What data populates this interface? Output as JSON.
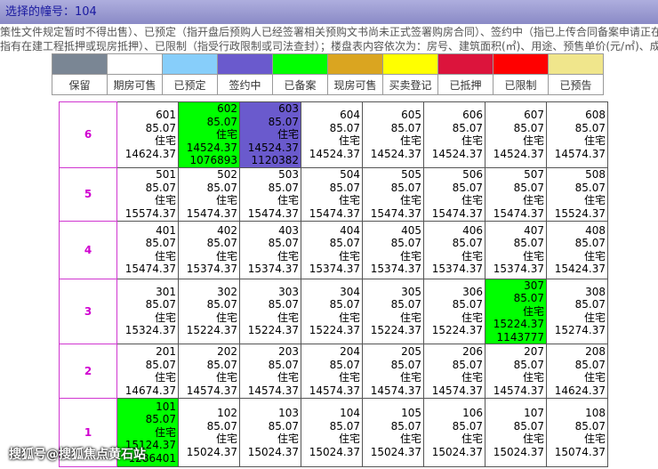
{
  "header": {
    "title": "选择的幢号：104"
  },
  "notice": {
    "line1": "策性文件规定暂时不得出售）、已预定（指开盘后预购人已经签署相关预购文书尚未正式签署购房合同）、签约中（指已上传合同备案申请正在审核",
    "line2": "指有在建工程抵押或现房抵押）、已限制（指受行政限制或司法查封）；楼盘表内容依次为：房号、建筑面积(㎡)、用途、预售单价(元/㎡)、成交总价"
  },
  "legend": [
    {
      "label": "保留",
      "color": "#7a8694"
    },
    {
      "label": "期房可售",
      "color": "#ffffff"
    },
    {
      "label": "已预定",
      "color": "#87cefa"
    },
    {
      "label": "签约中",
      "color": "#6a5acd"
    },
    {
      "label": "已备案",
      "color": "#00ff00"
    },
    {
      "label": "现房可售",
      "color": "#daa520"
    },
    {
      "label": "买卖登记",
      "color": "#ffff00"
    },
    {
      "label": "已抵押",
      "color": "#dc143c"
    },
    {
      "label": "已限制",
      "color": "#ff0000"
    },
    {
      "label": "已预告",
      "color": "#f0e68c"
    }
  ],
  "floors": [
    {
      "floor": "6",
      "units": [
        {
          "room": "601",
          "area": "85.07",
          "use": "住宅",
          "price": "14624.37",
          "total": "",
          "status": "期房可售"
        },
        {
          "room": "602",
          "area": "85.07",
          "use": "住宅",
          "price": "14524.37",
          "total": "1076893",
          "status": "已备案"
        },
        {
          "room": "603",
          "area": "85.07",
          "use": "住宅",
          "price": "14524.37",
          "total": "1120382",
          "status": "签约中"
        },
        {
          "room": "604",
          "area": "85.07",
          "use": "住宅",
          "price": "14524.37",
          "total": "",
          "status": "期房可售"
        },
        {
          "room": "605",
          "area": "85.07",
          "use": "住宅",
          "price": "14524.37",
          "total": "",
          "status": "期房可售"
        },
        {
          "room": "606",
          "area": "85.07",
          "use": "住宅",
          "price": "14524.37",
          "total": "",
          "status": "期房可售"
        },
        {
          "room": "607",
          "area": "85.07",
          "use": "住宅",
          "price": "14524.37",
          "total": "",
          "status": "期房可售"
        },
        {
          "room": "608",
          "area": "85.07",
          "use": "住宅",
          "price": "14574.37",
          "total": "",
          "status": "期房可售"
        }
      ]
    },
    {
      "floor": "5",
      "units": [
        {
          "room": "501",
          "area": "85.07",
          "use": "住宅",
          "price": "15574.37",
          "total": "",
          "status": "期房可售"
        },
        {
          "room": "502",
          "area": "85.07",
          "use": "住宅",
          "price": "15474.37",
          "total": "",
          "status": "期房可售"
        },
        {
          "room": "503",
          "area": "85.07",
          "use": "住宅",
          "price": "15474.37",
          "total": "",
          "status": "期房可售"
        },
        {
          "room": "504",
          "area": "85.07",
          "use": "住宅",
          "price": "15474.37",
          "total": "",
          "status": "期房可售"
        },
        {
          "room": "505",
          "area": "85.07",
          "use": "住宅",
          "price": "15474.37",
          "total": "",
          "status": "期房可售"
        },
        {
          "room": "506",
          "area": "85.07",
          "use": "住宅",
          "price": "15474.37",
          "total": "",
          "status": "期房可售"
        },
        {
          "room": "507",
          "area": "85.07",
          "use": "住宅",
          "price": "15474.37",
          "total": "",
          "status": "期房可售"
        },
        {
          "room": "508",
          "area": "85.07",
          "use": "住宅",
          "price": "15524.37",
          "total": "",
          "status": "期房可售"
        }
      ]
    },
    {
      "floor": "4",
      "units": [
        {
          "room": "401",
          "area": "85.07",
          "use": "住宅",
          "price": "15474.37",
          "total": "",
          "status": "期房可售"
        },
        {
          "room": "402",
          "area": "85.07",
          "use": "住宅",
          "price": "15374.37",
          "total": "",
          "status": "期房可售"
        },
        {
          "room": "403",
          "area": "85.07",
          "use": "住宅",
          "price": "15374.37",
          "total": "",
          "status": "期房可售"
        },
        {
          "room": "404",
          "area": "85.07",
          "use": "住宅",
          "price": "15374.37",
          "total": "",
          "status": "期房可售"
        },
        {
          "room": "405",
          "area": "85.07",
          "use": "住宅",
          "price": "15374.37",
          "total": "",
          "status": "期房可售"
        },
        {
          "room": "406",
          "area": "85.07",
          "use": "住宅",
          "price": "15374.37",
          "total": "",
          "status": "期房可售"
        },
        {
          "room": "407",
          "area": "85.07",
          "use": "住宅",
          "price": "15374.37",
          "total": "",
          "status": "期房可售"
        },
        {
          "room": "408",
          "area": "85.07",
          "use": "住宅",
          "price": "15424.37",
          "total": "",
          "status": "期房可售"
        }
      ]
    },
    {
      "floor": "3",
      "units": [
        {
          "room": "301",
          "area": "85.07",
          "use": "住宅",
          "price": "15324.37",
          "total": "",
          "status": "期房可售"
        },
        {
          "room": "302",
          "area": "85.07",
          "use": "住宅",
          "price": "15224.37",
          "total": "",
          "status": "期房可售"
        },
        {
          "room": "303",
          "area": "85.07",
          "use": "住宅",
          "price": "15224.37",
          "total": "",
          "status": "期房可售"
        },
        {
          "room": "304",
          "area": "85.07",
          "use": "住宅",
          "price": "15224.37",
          "total": "",
          "status": "期房可售"
        },
        {
          "room": "305",
          "area": "85.07",
          "use": "住宅",
          "price": "15224.37",
          "total": "",
          "status": "期房可售"
        },
        {
          "room": "306",
          "area": "85.07",
          "use": "住宅",
          "price": "15224.37",
          "total": "",
          "status": "期房可售"
        },
        {
          "room": "307",
          "area": "85.07",
          "use": "住宅",
          "price": "15224.37",
          "total": "1143777",
          "status": "已备案"
        },
        {
          "room": "308",
          "area": "85.07",
          "use": "住宅",
          "price": "15274.37",
          "total": "",
          "status": "期房可售"
        }
      ]
    },
    {
      "floor": "2",
      "units": [
        {
          "room": "201",
          "area": "85.07",
          "use": "住宅",
          "price": "14674.37",
          "total": "",
          "status": "期房可售"
        },
        {
          "room": "202",
          "area": "85.07",
          "use": "住宅",
          "price": "14574.37",
          "total": "",
          "status": "期房可售"
        },
        {
          "room": "203",
          "area": "85.07",
          "use": "住宅",
          "price": "14574.37",
          "total": "",
          "status": "期房可售"
        },
        {
          "room": "204",
          "area": "85.07",
          "use": "住宅",
          "price": "14574.37",
          "total": "",
          "status": "期房可售"
        },
        {
          "room": "205",
          "area": "85.07",
          "use": "住宅",
          "price": "14574.37",
          "total": "",
          "status": "期房可售"
        },
        {
          "room": "206",
          "area": "85.07",
          "use": "住宅",
          "price": "14574.37",
          "total": "",
          "status": "期房可售"
        },
        {
          "room": "207",
          "area": "85.07",
          "use": "住宅",
          "price": "14574.37",
          "total": "",
          "status": "期房可售"
        },
        {
          "room": "208",
          "area": "85.07",
          "use": "住宅",
          "price": "14624.37",
          "total": "",
          "status": "期房可售"
        }
      ]
    },
    {
      "floor": "1",
      "units": [
        {
          "room": "101",
          "area": "85.07",
          "use": "住宅",
          "price": "15124.37",
          "total": "1286401",
          "status": "已备案"
        },
        {
          "room": "102",
          "area": "85.07",
          "use": "住宅",
          "price": "15024.37",
          "total": "",
          "status": "期房可售"
        },
        {
          "room": "103",
          "area": "85.07",
          "use": "住宅",
          "price": "15024.37",
          "total": "",
          "status": "期房可售"
        },
        {
          "room": "104",
          "area": "85.07",
          "use": "住宅",
          "price": "15024.37",
          "total": "",
          "status": "期房可售"
        },
        {
          "room": "105",
          "area": "85.07",
          "use": "住宅",
          "price": "15024.37",
          "total": "",
          "status": "期房可售"
        },
        {
          "room": "106",
          "area": "85.07",
          "use": "住宅",
          "price": "15024.37",
          "total": "",
          "status": "期房可售"
        },
        {
          "room": "107",
          "area": "85.07",
          "use": "住宅",
          "price": "15024.37",
          "total": "",
          "status": "期房可售"
        },
        {
          "room": "108",
          "area": "85.07",
          "use": "住宅",
          "price": "15074.37",
          "total": "",
          "status": "期房可售"
        }
      ]
    }
  ],
  "watermark": "搜狐号@搜狐焦点黄石站"
}
